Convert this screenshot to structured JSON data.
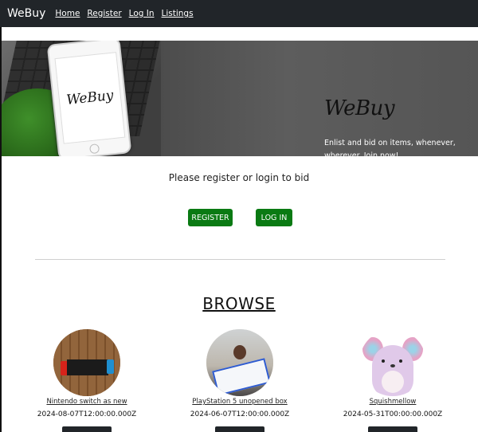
{
  "navbar": {
    "brand": "WeBuy",
    "links": [
      "Home",
      "Register",
      "Log In",
      "Listings"
    ]
  },
  "hero": {
    "phone_logo": "WeBuy",
    "logo": "WeBuy",
    "tagline": "Enlist and bid on items, whenever, wherever. Join now!"
  },
  "auth": {
    "prompt": "Please register or login to bid",
    "register_label": "REGISTER",
    "login_label": "LOG IN"
  },
  "browse": {
    "heading": "BROWSE",
    "listings": [
      {
        "title": "Nintendo switch as new",
        "date": "2024-08-07T12:00:00.000Z",
        "image": "nintendo-switch-photo"
      },
      {
        "title": "PlayStation 5 unopened box",
        "date": "2024-06-07T12:00:00.000Z",
        "image": "playstation-5-photo"
      },
      {
        "title": "Squishmellow",
        "date": "2024-05-31T00:00:00.000Z",
        "image": "squishmallow-plush-photo"
      }
    ]
  },
  "colors": {
    "navbar": "#212529",
    "button_green": "#0a7a13"
  }
}
